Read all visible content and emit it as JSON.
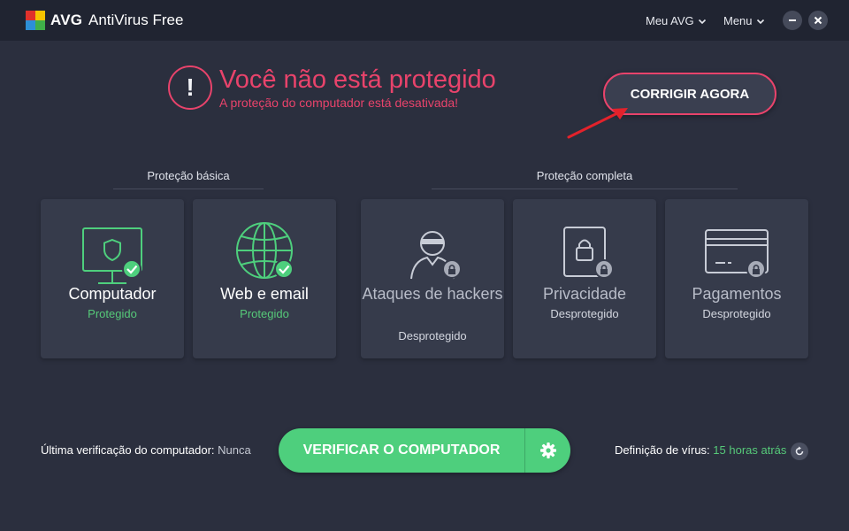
{
  "titlebar": {
    "brand": "AVG",
    "product": "AntiVirus Free",
    "my_avg": "Meu AVG",
    "menu": "Menu"
  },
  "status": {
    "title": "Você não está protegido",
    "subtitle": "A proteção do computador está desativada!",
    "alert_glyph": "!",
    "fix_button": "CORRIGIR AGORA"
  },
  "groups": {
    "basic": "Proteção básica",
    "full": "Proteção completa"
  },
  "cards": [
    {
      "name": "Computador",
      "state": "Protegido",
      "icon": "monitor-shield-icon",
      "protected": true
    },
    {
      "name": "Web e email",
      "state": "Protegido",
      "icon": "globe-icon",
      "protected": true
    },
    {
      "name": "Ataques de hackers",
      "state": "Desprotegido",
      "icon": "hacker-icon",
      "protected": false
    },
    {
      "name": "Privacidade",
      "state": "Desprotegido",
      "icon": "privacy-lock-icon",
      "protected": false
    },
    {
      "name": "Pagamentos",
      "state": "Desprotegido",
      "icon": "credit-card-icon",
      "protected": false
    }
  ],
  "footer": {
    "last_scan_label": "Última verificação do computador:",
    "last_scan_value": "Nunca",
    "scan_button": "VERIFICAR O COMPUTADOR",
    "virus_def_label": "Definição de vírus:",
    "virus_def_value": "15 horas atrás"
  },
  "colors": {
    "background": "#2b2f3e",
    "titlebar": "#202431",
    "card": "#363b4b",
    "alert": "#e8436b",
    "protected_green": "#56c979",
    "scan_button": "#4ecf7d"
  }
}
